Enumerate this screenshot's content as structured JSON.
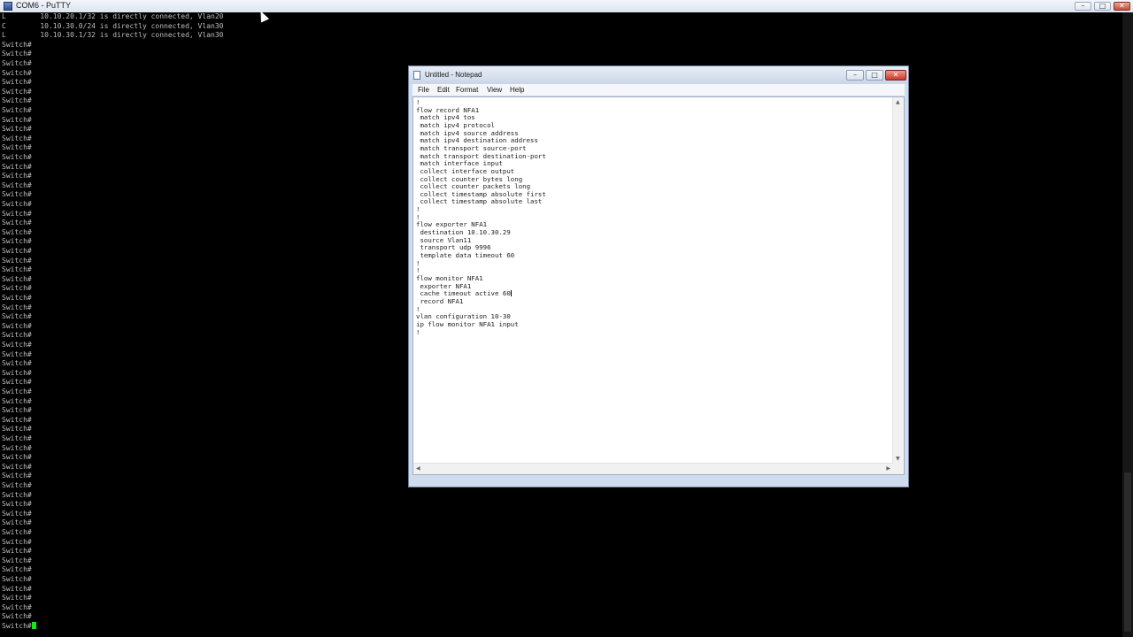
{
  "putty": {
    "title": "COM6 - PuTTY",
    "controls": {
      "minimize": "–",
      "maximize": "□",
      "close": "✕"
    },
    "route_lines": [
      "L        10.10.20.1/32 is directly connected, Vlan20",
      "C        10.10.30.0/24 is directly connected, Vlan30",
      "L        10.10.30.1/32 is directly connected, Vlan30"
    ],
    "prompt": "Switch#"
  },
  "notepad": {
    "title": "Untitled - Notepad",
    "controls": {
      "minimize": "–",
      "maximize": "□",
      "close": "✕"
    },
    "menu": [
      "File",
      "Edit",
      "Format",
      "View",
      "Help"
    ],
    "lines": [
      "!",
      "flow record NFA1",
      " match ipv4 tos",
      " match ipv4 protocol",
      " match ipv4 source address",
      " match ipv4 destination address",
      " match transport source-port",
      " match transport destination-port",
      " match interface input",
      " collect interface output",
      " collect counter bytes long",
      " collect counter packets long",
      " collect timestamp absolute first",
      " collect timestamp absolute last",
      "!",
      "!",
      "flow exporter NFA1",
      " destination 10.10.30.29",
      " source Vlan11",
      " transport udp 9996",
      " template data timeout 60",
      "!",
      "!",
      "flow monitor NFA1",
      " exporter NFA1",
      " cache timeout active 60",
      " record NFA1",
      "!",
      "vlan configuration 10-30",
      "ip flow monitor NFA1 input",
      "!"
    ]
  }
}
